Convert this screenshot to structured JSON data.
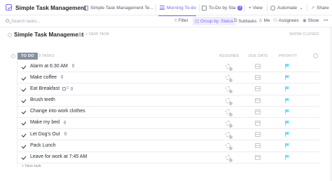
{
  "app": {
    "title": "Simple Task Management",
    "caret": "⌄"
  },
  "tabs": [
    {
      "label": "Simple Task Management Te...",
      "active": false
    },
    {
      "label": "Morning To-do",
      "active": true
    },
    {
      "label": "To-Do by Sta",
      "badge": "3",
      "active": false
    },
    {
      "label": "+ View",
      "active": false
    },
    {
      "label": "Automate",
      "caret": "⌄",
      "active": false
    },
    {
      "label": "Share",
      "active": false
    }
  ],
  "toolbar": {
    "search_placeholder": "Search tasks...",
    "filter": "Filter",
    "group_by": "Group by: Status",
    "subtasks": "Subtasks",
    "me": "Me",
    "assignees": "Assignees",
    "show": "Show",
    "more": "•••"
  },
  "header": {
    "title": "Simple Task Management",
    "new_task": "+ NEW TASK",
    "show_closed": "SHOW CLOSED"
  },
  "group": {
    "status": "TO DO",
    "count": "9 TASKS",
    "columns": {
      "assignee": "ASSIGNEE",
      "due_date": "DUE DATE",
      "priority": "PRIORITY"
    }
  },
  "tasks": [
    {
      "name": "Alarm at 6:30 AM",
      "subtasks": "",
      "attachment": true
    },
    {
      "name": "Make coffee",
      "subtasks": "",
      "attachment": true
    },
    {
      "name": "Eat Breakfast",
      "subtasks": "3",
      "attachment": true,
      "expandable": true
    },
    {
      "name": "Brush teeth",
      "subtasks": "",
      "attachment": false
    },
    {
      "name": "Change into work clothes",
      "subtasks": "",
      "attachment": false
    },
    {
      "name": "Make my bed",
      "subtasks": "",
      "attachment": true
    },
    {
      "name": "Let Dog's Out",
      "subtasks": "",
      "attachment": true
    },
    {
      "name": "Pack Lunch",
      "subtasks": "",
      "attachment": false
    },
    {
      "name": "Leave for work at 7:45 AM",
      "subtasks": "",
      "attachment": false
    }
  ],
  "footer": {
    "new_task": "+ New task"
  },
  "colors": {
    "accent": "#7b68ee",
    "priority_flag": "#6fddff",
    "status_todo": "#87909e"
  },
  "icons": [
    "checklist-icon",
    "doc-icon",
    "list-view-icon",
    "board-icon",
    "automate-icon",
    "share-icon",
    "search-icon",
    "filter-icon",
    "group-icon",
    "subtasks-icon",
    "person-icon",
    "assignees-icon",
    "show-icon",
    "info-icon",
    "calendar-icon",
    "flag-icon",
    "attachment-icon"
  ]
}
